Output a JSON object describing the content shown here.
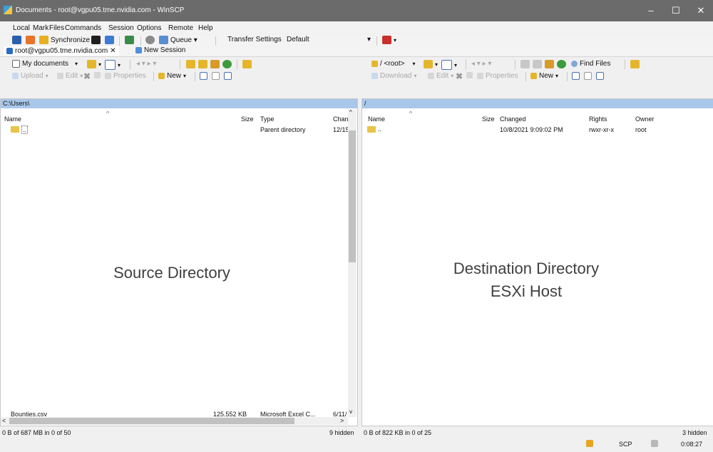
{
  "window": {
    "title": "Documents - root@vgpu05.tme.nvidia.com - WinSCP",
    "minimize": "–",
    "maximize": "☐",
    "close": "✕"
  },
  "menu": [
    "Local",
    "Mark",
    "Files",
    "Commands",
    "Session",
    "Options",
    "Remote",
    "Help"
  ],
  "toolbar1": {
    "synchronize": "Synchronize",
    "queue": "Queue ▾",
    "transfer_settings": "Transfer Settings",
    "transfer_value": "Default",
    "transfer_dropdown": "▾"
  },
  "tabs": {
    "session_tab": "root@vgpu05.tme.nvidia.com",
    "session_close": "✕",
    "new_session": "New Session"
  },
  "left_toolbar": {
    "location": "My documents",
    "upload": "Upload",
    "edit": "Edit",
    "properties": "Properties",
    "new": "New"
  },
  "right_toolbar": {
    "location": "/ <root>",
    "find_files": "Find Files",
    "download": "Download",
    "edit": "Edit",
    "properties": "Properties",
    "new": "New"
  },
  "left_panel": {
    "path": "C:\\Users\\",
    "columns": {
      "name": "Name",
      "size": "Size",
      "type": "Type",
      "changed": "Chan"
    },
    "rows": [
      {
        "name": "..",
        "size": "",
        "type": "Parent directory",
        "changed": "12/15"
      }
    ],
    "partial_row": {
      "name": "Bounties.csv",
      "size": "125,552 KB",
      "type": "Microsoft Excel C...",
      "changed": "6/11/"
    },
    "overlay": "Source Directory"
  },
  "right_panel": {
    "path": "/",
    "columns": {
      "name": "Name",
      "size": "Size",
      "changed": "Changed",
      "rights": "Rights",
      "owner": "Owner"
    },
    "rows": [
      {
        "name": "..",
        "size": "",
        "changed": "10/8/2021 9:09:02 PM",
        "rights": "rwxr-xr-x",
        "owner": "root"
      }
    ],
    "overlay_line1": "Destination Directory",
    "overlay_line2": "ESXi Host"
  },
  "status": {
    "left": "0 B of 687 MB in 0 of 50",
    "left_hidden": "9 hidden",
    "right": "0 B of 822 KB in 0 of 25",
    "right_hidden": "3 hidden",
    "protocol": "SCP",
    "time": "0:08:27"
  }
}
